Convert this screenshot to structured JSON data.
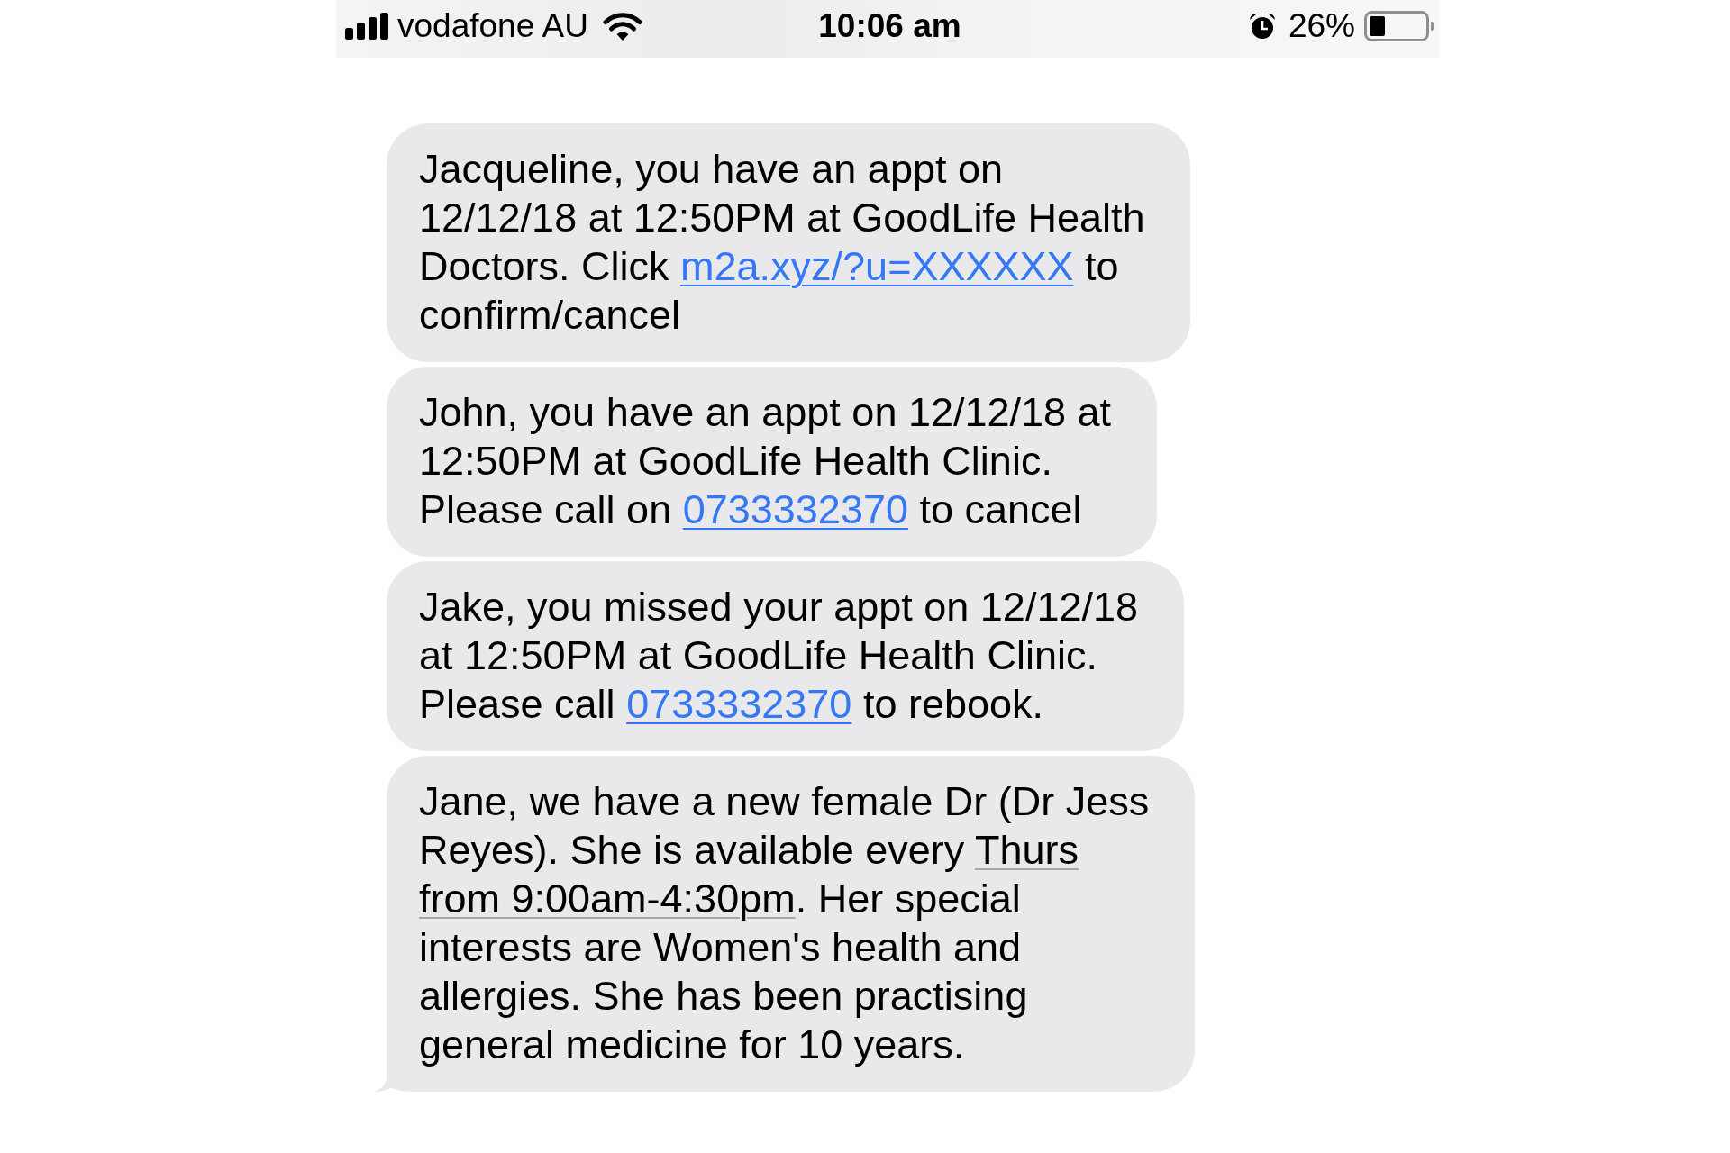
{
  "status_bar": {
    "carrier": "vodafone AU",
    "time": "10:06 am",
    "battery": "26%"
  },
  "messages": [
    {
      "segments": [
        {
          "kind": "text",
          "text": "Jacqueline, you have an appt on 12/12/18 at 12:50PM at GoodLife Health Doctors. Click "
        },
        {
          "kind": "link",
          "text": "m2a.xyz/?u=XXXXXX"
        },
        {
          "kind": "text",
          "text": " to confirm/cancel"
        }
      ],
      "tail": false
    },
    {
      "segments": [
        {
          "kind": "text",
          "text": "John, you have an appt on 12/12/18 at 12:50PM at GoodLife Health Clinic. Please call on "
        },
        {
          "kind": "link",
          "text": "0733332370"
        },
        {
          "kind": "text",
          "text": " to cancel"
        }
      ],
      "tail": false
    },
    {
      "segments": [
        {
          "kind": "text",
          "text": "Jake, you missed your appt on 12/12/18 at 12:50PM at GoodLife Health Clinic. Please call "
        },
        {
          "kind": "link",
          "text": "0733332370"
        },
        {
          "kind": "text",
          "text": " to rebook."
        }
      ],
      "tail": false
    },
    {
      "segments": [
        {
          "kind": "text",
          "text": "Jane, we have a new female Dr (Dr Jess Reyes). She is available every "
        },
        {
          "kind": "date",
          "text": "Thurs from 9:00am-4:30pm"
        },
        {
          "kind": "text",
          "text": ". Her special interests are Women's health and allergies. She has been practising general medicine for 10 years."
        }
      ],
      "tail": true
    }
  ]
}
